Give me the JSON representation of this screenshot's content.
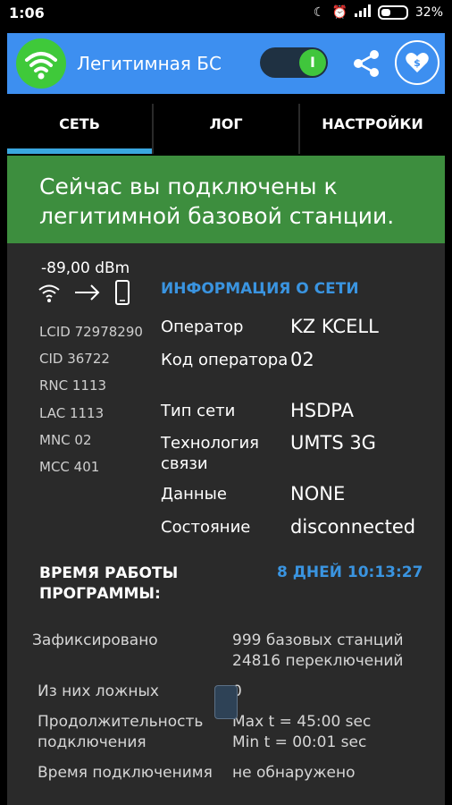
{
  "status_bar": {
    "time": "1:06",
    "battery": "32%",
    "icons": [
      "moon-icon",
      "alarm-icon",
      "signal-icon",
      "battery-icon"
    ]
  },
  "app_bar": {
    "title": "Легитимная БС",
    "toggle_knob": "I",
    "toggle_on": true,
    "colors": {
      "bar": "#3d8ff0",
      "icon_bg": "#3fc93a"
    }
  },
  "tabs": [
    {
      "label": "СЕТЬ",
      "active": true
    },
    {
      "label": "ЛОГ",
      "active": false
    },
    {
      "label": "НАСТРОЙКИ",
      "active": false
    }
  ],
  "banner": {
    "text": "Сейчас вы подключены к легитимной базовой станции.",
    "color": "#3d8e3e"
  },
  "signal": {
    "strength": "-89,00 dBm"
  },
  "cell_ids": [
    "LCID 72978290",
    "CID 36722",
    "RNC 1113",
    "LAC 1113",
    "MNC 02",
    "MCC 401"
  ],
  "network_info": {
    "title": "ИНФОРМАЦИЯ О СЕТИ",
    "rows": [
      {
        "label": "Оператор",
        "value": "KZ KCELL"
      },
      {
        "label": "Код оператора",
        "value": "02"
      },
      {
        "label": "Тип сети",
        "value": "HSDPA"
      },
      {
        "label": "Технология связи",
        "value": "UMTS 3G"
      },
      {
        "label": "Данные",
        "value": "NONE"
      },
      {
        "label": "Состояние",
        "value": "disconnected"
      }
    ]
  },
  "uptime": {
    "label": "ВРЕМЯ РАБОТЫ ПРОГРАММЫ:",
    "value": "8 ДНЕЙ 10:13:27"
  },
  "stats": {
    "recorded_label": "Зафиксировано",
    "recorded_value1": "999 базовых станций",
    "recorded_value2": "24816 переключений",
    "fake_label": "Из них ложных",
    "fake_value": "0",
    "duration_label": "Продолжительность подключения",
    "duration_max": "Max t = 45:00 sec",
    "duration_min": "Min t = 00:01 sec",
    "time_label": "Время подключенимя",
    "time_value": "не обнаружено"
  }
}
